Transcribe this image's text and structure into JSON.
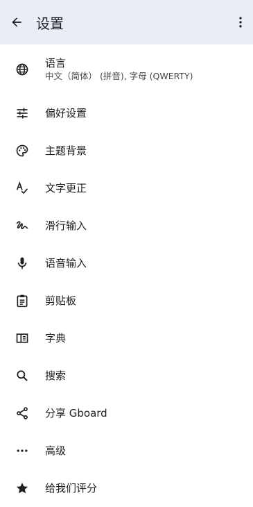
{
  "header": {
    "title": "设置"
  },
  "items": [
    {
      "label": "语言",
      "sub": "中文（简体） (拼音), 字母 (QWERTY)",
      "icon": "globe-icon"
    },
    {
      "label": "偏好设置",
      "icon": "tune-icon"
    },
    {
      "label": "主题背景",
      "icon": "palette-icon"
    },
    {
      "label": "文字更正",
      "icon": "spellcheck-icon"
    },
    {
      "label": "滑行输入",
      "icon": "gesture-icon"
    },
    {
      "label": "语音输入",
      "icon": "microphone-icon"
    },
    {
      "label": "剪贴板",
      "icon": "clipboard-icon"
    },
    {
      "label": "字典",
      "icon": "book-icon"
    },
    {
      "label": "搜索",
      "icon": "search-icon"
    },
    {
      "label": "分享 Gboard",
      "icon": "share-icon"
    },
    {
      "label": "高级",
      "icon": "more-horizontal-icon"
    },
    {
      "label": "给我们评分",
      "icon": "star-icon"
    }
  ]
}
